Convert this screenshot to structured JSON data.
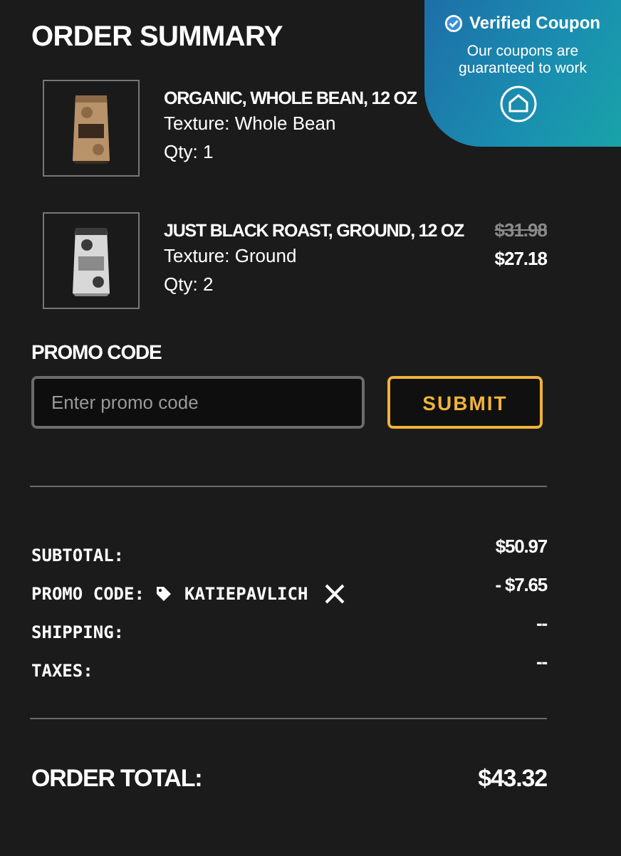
{
  "title": "ORDER SUMMARY",
  "items": [
    {
      "name": "ORGANIC, WHOLE BEAN, 12 OZ",
      "texture": "Texture: Whole Bean",
      "qty": "Qty: 1",
      "kind": "picture"
    },
    {
      "name": "JUST BLACK ROAST, GROUND, 12 OZ",
      "texture": "Texture: Ground",
      "qty": "Qty: 2",
      "kind": "picture",
      "old_price": "$31.98",
      "price": "$27.18"
    }
  ],
  "promo": {
    "label": "PROMO CODE",
    "placeholder": "Enter promo code",
    "button": "SUBMIT"
  },
  "summary": [
    {
      "label": "SUBTOTAL:",
      "value": "$50.97"
    },
    {
      "label": "PROMO CODE:",
      "code": "KATIEPAVLICH",
      "value": "- $7.65"
    },
    {
      "label": "SHIPPING:",
      "value": "--"
    },
    {
      "label": "TAXES:",
      "value": "--"
    }
  ],
  "total": {
    "label": "ORDER TOTAL:",
    "value": "$43.32"
  },
  "coupon_badge": {
    "title": "Verified Coupon",
    "text": "Our coupons are guaranteed to work"
  }
}
